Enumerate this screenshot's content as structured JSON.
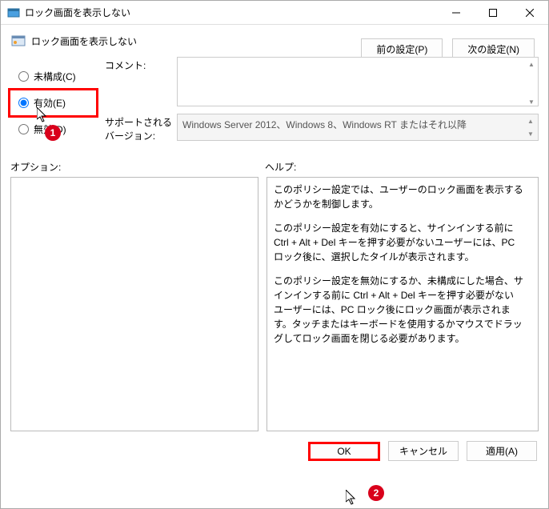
{
  "window": {
    "title": "ロック画面を表示しない",
    "subheader": "ロック画面を表示しない"
  },
  "nav": {
    "prev": "前の設定(P)",
    "next": "次の設定(N)"
  },
  "radios": {
    "not_configured": "未構成(C)",
    "enabled": "有効(E)",
    "disabled": "無効(D)"
  },
  "fields": {
    "comment_label": "コメント:",
    "version_label": "サポートされるバージョン:",
    "version_text": "Windows Server 2012、Windows 8、Windows RT またはそれ以降"
  },
  "sections": {
    "options": "オプション:",
    "help": "ヘルプ:"
  },
  "help": {
    "p1": "このポリシー設定では、ユーザーのロック画面を表示するかどうかを制御します。",
    "p2": "このポリシー設定を有効にすると、サインインする前に Ctrl + Alt + Del キーを押す必要がないユーザーには、PC ロック後に、選択したタイルが表示されます。",
    "p3": "このポリシー設定を無効にするか、未構成にした場合、サインインする前に Ctrl + Alt + Del キーを押す必要がないユーザーには、PC ロック後にロック画面が表示されます。タッチまたはキーボードを使用するかマウスでドラッグしてロック画面を閉じる必要があります。"
  },
  "buttons": {
    "ok": "OK",
    "cancel": "キャンセル",
    "apply": "適用(A)"
  },
  "annotations": {
    "a1": "1",
    "a2": "2"
  }
}
